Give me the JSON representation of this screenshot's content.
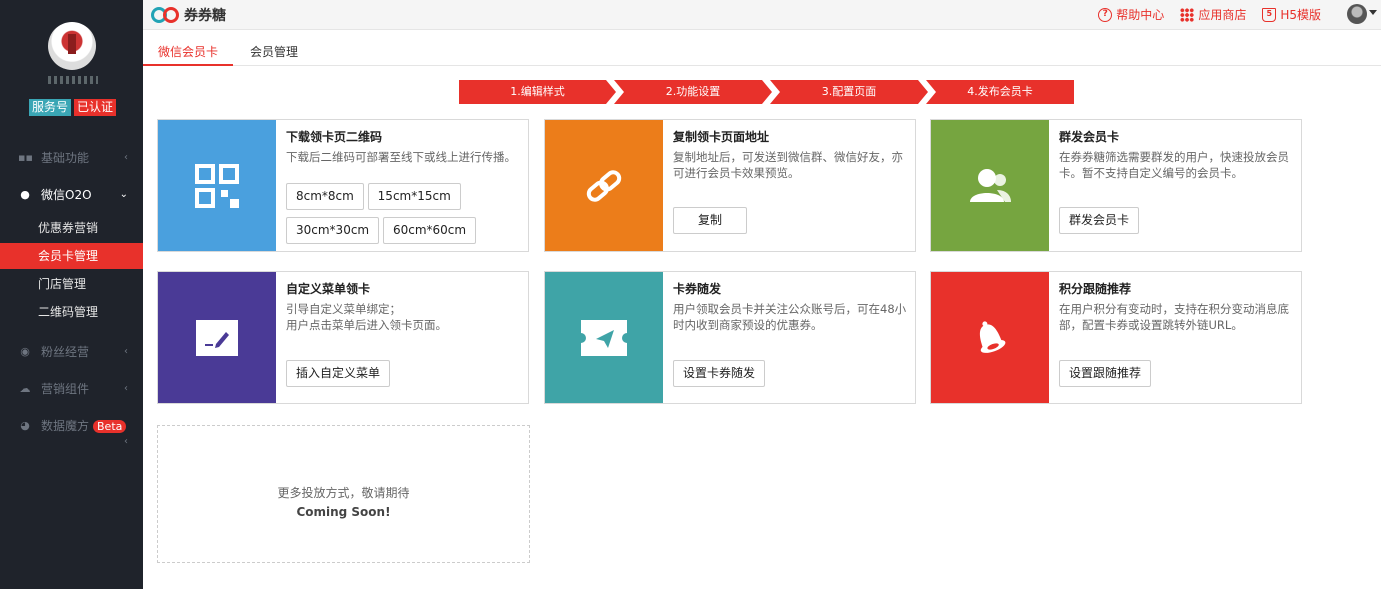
{
  "sidebar": {
    "badges": {
      "service": "服务号",
      "verified": "已认证"
    },
    "menu": [
      {
        "label": "基础功能",
        "icon": "grid-icon",
        "chevron": "‹"
      },
      {
        "label": "微信O2O",
        "icon": "wechat-icon",
        "chevron": "⌄"
      },
      {
        "label": "粉丝经营",
        "icon": "users-icon",
        "chevron": "‹"
      },
      {
        "label": "营销组件",
        "icon": "cloud-icon",
        "chevron": "‹"
      },
      {
        "label": "数据魔方",
        "icon": "pie-icon",
        "chevron": "‹",
        "badge": "Beta"
      }
    ],
    "submenu": [
      "优惠券营销",
      "会员卡管理",
      "门店管理",
      "二维码管理"
    ]
  },
  "topbar": {
    "brand": "券券糖",
    "links": {
      "help": "帮助中心",
      "store": "应用商店",
      "h5": "H5模版"
    }
  },
  "tabs": [
    "微信会员卡",
    "会员管理"
  ],
  "steps": [
    "1.编辑样式",
    "2.功能设置",
    "3.配置页面",
    "4.发布会员卡"
  ],
  "cards": {
    "qrcode": {
      "title": "下载领卡页二维码",
      "desc": "下载后二维码可部署至线下或线上进行传播。",
      "sizes": [
        "8cm*8cm",
        "15cm*15cm",
        "30cm*30cm",
        "60cm*60cm"
      ],
      "color": "#4aa0de"
    },
    "copy": {
      "title": "复制领卡页面地址",
      "desc": "复制地址后，可发送到微信群、微信好友，亦可进行会员卡效果预览。",
      "button": "复制",
      "color": "#ec7d1a"
    },
    "group": {
      "title": "群发会员卡",
      "desc": "在券券糖筛选需要群发的用户，快速投放会员卡。暂不支持自定义编号的会员卡。",
      "button": "群发会员卡",
      "color": "#76a540"
    },
    "menu": {
      "title": "自定义菜单领卡",
      "desc1": "引导自定义菜单绑定；",
      "desc2": "用户点击菜单后进入领卡页面。",
      "button": "插入自定义菜单",
      "color": "#4a3a96"
    },
    "coupon": {
      "title": "卡券随发",
      "desc": "用户领取会员卡并关注公众账号后，可在48小时内收到商家预设的优惠券。",
      "button": "设置卡券随发",
      "color": "#3fa4a7"
    },
    "points": {
      "title": "积分跟随推荐",
      "desc": "在用户积分有变动时，支持在积分变动消息底部，配置卡券或设置跳转外链URL。",
      "button": "设置跟随推荐",
      "color": "#e8312b"
    }
  },
  "coming_soon": {
    "line1": "更多投放方式，敬请期待",
    "line2": "Coming Soon!"
  }
}
